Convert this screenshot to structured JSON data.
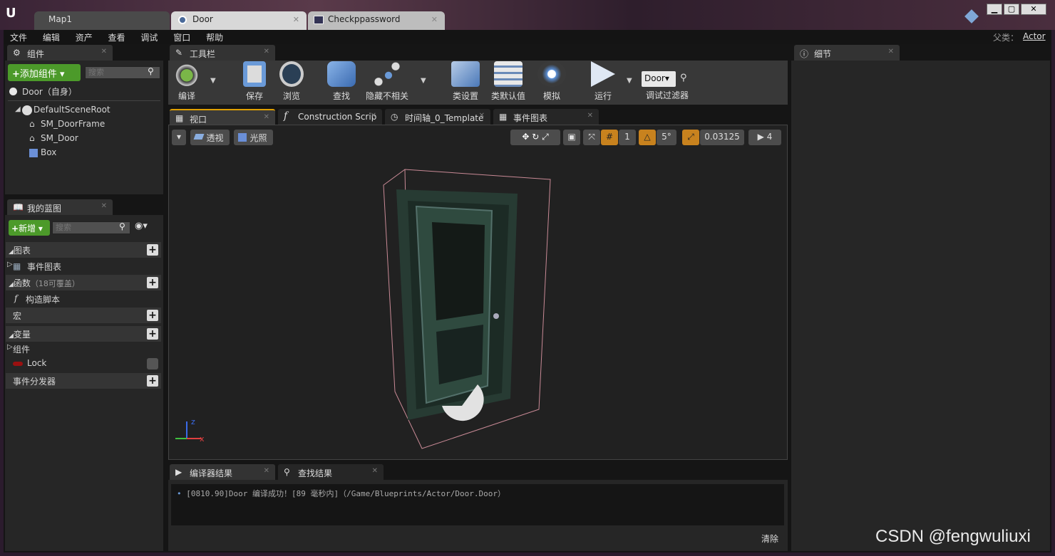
{
  "title_tabs": [
    {
      "label": "Map1"
    },
    {
      "label": "Door"
    },
    {
      "label": "Checkppassword"
    }
  ],
  "window_controls": {
    "minimize": "▁",
    "maximize": "▢",
    "close": "✕"
  },
  "menu": [
    "文件",
    "编辑",
    "资产",
    "查看",
    "调试",
    "窗口",
    "帮助"
  ],
  "parent": {
    "label": "父类：",
    "value": "Actor"
  },
  "components_panel": {
    "title": "组件",
    "add_button": "添加组件",
    "search_placeholder": "搜索",
    "self_item": "Door（自身）",
    "tree": [
      "DefaultSceneRoot",
      "SM_DoorFrame",
      "SM_Door",
      "Box"
    ]
  },
  "blueprint_panel": {
    "title": "我的蓝图",
    "new_button": "新增",
    "search_placeholder": "搜索",
    "sections": {
      "graphs": "图表",
      "event_graph": "事件图表",
      "functions": "函数",
      "functions_note": "（18可覆盖）",
      "construction_script": "构造脚本",
      "macros": "宏",
      "variables": "变量",
      "components": "组件",
      "lock_var": "Lock",
      "dispatchers": "事件分发器"
    }
  },
  "toolbar_panel": {
    "title": "工具栏",
    "buttons": [
      "编译",
      "保存",
      "浏览",
      "查找",
      "隐藏不相关",
      "类设置",
      "类默认值",
      "模拟",
      "运行"
    ],
    "debug_filter_value": "Door",
    "debug_filter_label": "调试过滤器"
  },
  "editor_tabs": [
    "视口",
    "Construction Scrip",
    "时间轴_0_Template",
    "事件图表"
  ],
  "viewport": {
    "perspective": "透视",
    "lit": "光照",
    "grid_snap": "1",
    "rot_snap": "5°",
    "scale_snap": "0.03125",
    "camera_speed": "4",
    "axis_x": "x",
    "axis_z": "z"
  },
  "bottom_tabs": [
    "编译器结果",
    "查找结果"
  ],
  "compiler_log": "[0810.90]Door 编译成功！[89 毫秒内]（/Game/Blueprints/Actor/Door.Door）",
  "clear_button": "清除",
  "details_panel": {
    "title": "细节"
  },
  "watermark": "CSDN @fengwuliuxi",
  "colors": {
    "accent_green": "#4c9a2a",
    "snap_orange": "#c8821e",
    "lock_var": "#9a1010"
  }
}
